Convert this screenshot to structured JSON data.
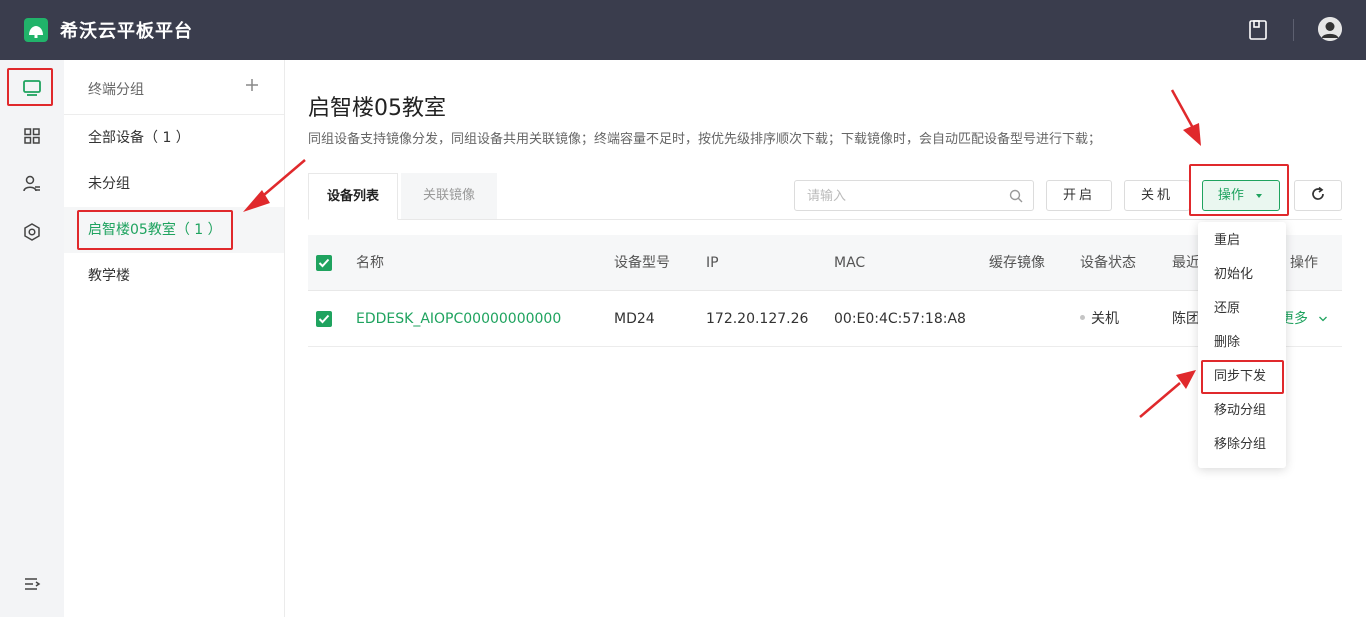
{
  "app": {
    "title": "希沃云平板平台"
  },
  "groups": {
    "header": "终端分组",
    "items": [
      "全部设备（ 1 ）",
      "未分组",
      "启智楼05教室（ 1 ）",
      "教学楼"
    ],
    "active_index": 2
  },
  "page": {
    "title": "启智楼05教室",
    "description": "同组设备支持镜像分发，同组设备共用关联镜像；终端容量不足时，按优先级排序顺次下载；下载镜像时，会自动匹配设备型号进行下载；"
  },
  "tabs": [
    "设备列表",
    "关联镜像"
  ],
  "search": {
    "placeholder": "请输入"
  },
  "toolbar": {
    "open": "开启",
    "off": "关机",
    "operations": "操作"
  },
  "table": {
    "columns": [
      "名称",
      "设备型号",
      "IP",
      "MAC",
      "缓存镜像",
      "设备状态",
      "最近",
      "操作"
    ],
    "rows": [
      {
        "name": "EDDESK_AIOPC00000000000",
        "model": "MD24",
        "ip": "172.20.127.26",
        "mac": "00:E0:4C:57:18:A8",
        "cache": "",
        "status": "关机",
        "recent": "陈团",
        "more": "更多"
      }
    ]
  },
  "dropdown": {
    "items": [
      "重启",
      "初始化",
      "还原",
      "删除",
      "同步下发",
      "移动分组",
      "移除分组"
    ]
  },
  "colors": {
    "accent": "#1fa35f",
    "header_bg": "#3a3d4d",
    "annotation": "#e0292c"
  },
  "icons": [
    "logo-icon",
    "save-icon",
    "avatar-icon",
    "device-icon",
    "apps-icon",
    "user-manage-icon",
    "settings-icon",
    "collapse-icon",
    "plus-icon",
    "search-icon",
    "refresh-icon",
    "caret-down-icon",
    "chevron-down-icon"
  ]
}
